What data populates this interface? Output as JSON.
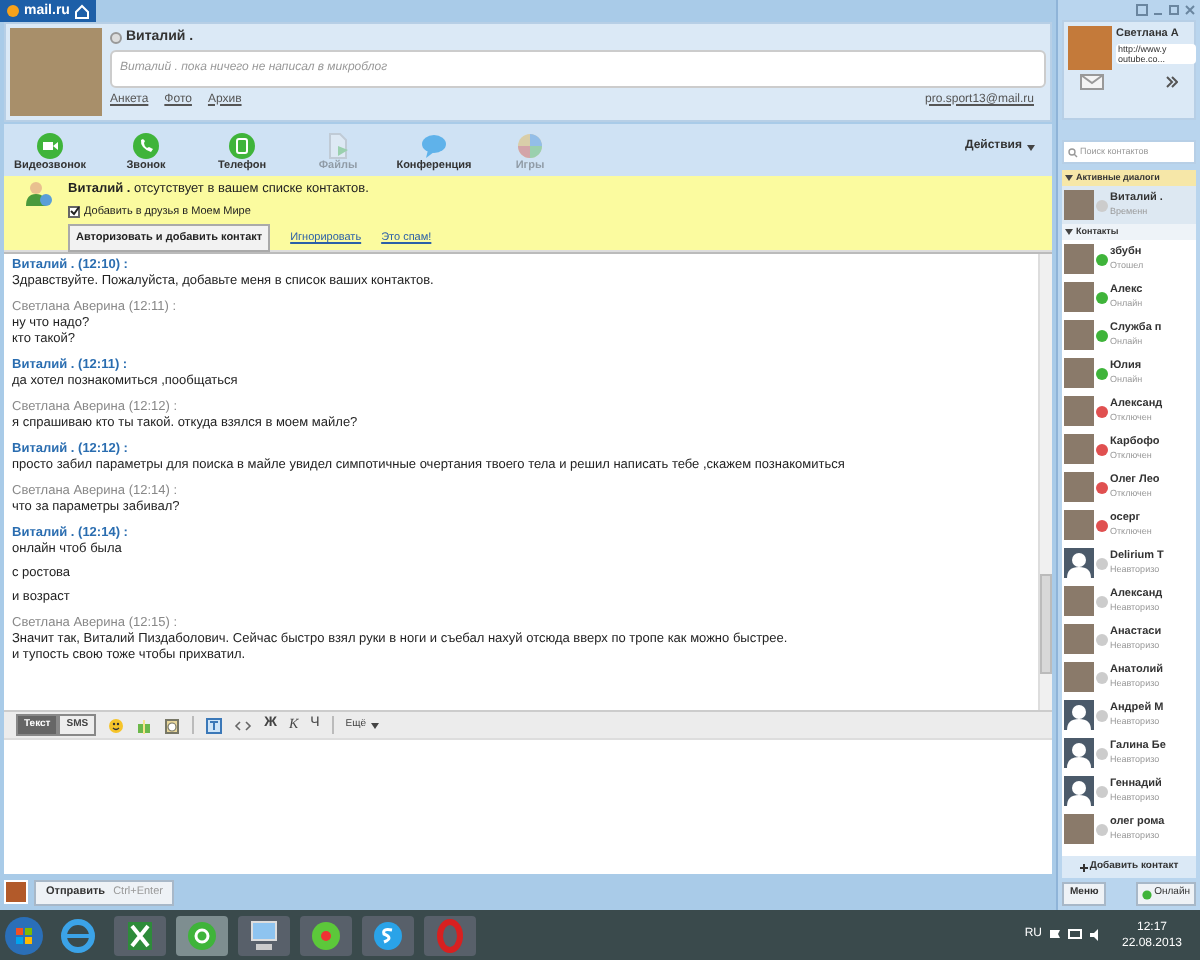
{
  "top_bar": {
    "logo": "mail.ru"
  },
  "profile": {
    "name": "Виталий .",
    "microblog_placeholder": "Виталий . пока ничего не написал в микроблог",
    "links": [
      "Анкета",
      "Фото",
      "Архив"
    ],
    "email": "pro.sport13@mail.ru"
  },
  "toolbar": {
    "items": [
      {
        "kind": "video",
        "label": "Видеозвонок",
        "disabled": false
      },
      {
        "kind": "call",
        "label": "Звонок",
        "disabled": false
      },
      {
        "kind": "phone",
        "label": "Телефон",
        "disabled": false
      },
      {
        "kind": "files",
        "label": "Файлы",
        "disabled": true
      },
      {
        "kind": "conference",
        "label": "Конференция",
        "disabled": false
      },
      {
        "kind": "games",
        "label": "Игры",
        "disabled": true
      }
    ],
    "actions": "Действия"
  },
  "notice": {
    "text": "**Виталий .** отсутствует в вашем списке контактов.",
    "checkbox": {
      "label": "Добавить в друзья в Моем Мире",
      "checked": true
    },
    "button": "Авторизовать и добавить контакт",
    "links": [
      "Игнорировать",
      "Это спам!"
    ]
  },
  "messages": [
    {
      "kind": "contact",
      "header": "Виталий . (12:10) :",
      "lines": [
        "Здравствуйте. Пожалуйста, добавьте меня в список ваших контактов."
      ]
    },
    {
      "kind": "me",
      "header": "Светлана Аверина (12:11) :",
      "lines": [
        "ну что надо?",
        "кто такой?"
      ]
    },
    {
      "kind": "contact",
      "header": "Виталий . (12:11) :",
      "lines": [
        "да хотел познакомиться ,пообщаться"
      ]
    },
    {
      "kind": "me",
      "header": "Светлана Аверина (12:12) :",
      "lines": [
        "я спрашиваю кто ты такой. откуда взялся в моем майле?"
      ]
    },
    {
      "kind": "contact",
      "header": "Виталий . (12:12) :",
      "lines": [
        "просто забил параметры для поиска в майле увидел симпотичные очертания твоего тела и решил написать тебе ,скажем познакомиться"
      ]
    },
    {
      "kind": "me",
      "header": "Светлана Аверина (12:14) :",
      "lines": [
        "что за параметры забивал?"
      ]
    },
    {
      "kind": "contact",
      "header": "Виталий . (12:14) :",
      "lines": [
        "онлайн чтоб была",
        "с ростова",
        "и возраст"
      ]
    },
    {
      "kind": "me",
      "header": "Светлана Аверина (12:15) :",
      "lines": [
        "Значит так, Виталий Пиздаболович. Сейчас быстро взял руки в ноги и съебал нахуй отсюда вверх по тропе как можно быстрее.",
        "и тупость свою тоже чтобы прихватил."
      ]
    }
  ],
  "format_bar": {
    "modes": [
      {
        "label": "Текст",
        "selected": true
      },
      {
        "label": "SMS",
        "selected": false
      }
    ],
    "bold": "Ж",
    "italic": "К",
    "underline": "Ч",
    "more": "Ещё"
  },
  "send": {
    "label": "Отправить",
    "shortcut": "Ctrl+Enter"
  },
  "sidebar": {
    "own": {
      "name": "Светлана А",
      "status": "http://www.y outube.co..."
    },
    "search_placeholder": "Поиск контактов",
    "active_header": "Активные диалоги",
    "active": [
      {
        "name": "Виталий .",
        "status": "Временн",
        "color": "#cccccc",
        "kind": "photo"
      }
    ],
    "contacts_header": "Контакты",
    "contacts": [
      {
        "name": "збубн",
        "status": "Отошел",
        "color": "#3fb43a",
        "kind": "photo"
      },
      {
        "name": "Алекс",
        "status": "Онлайн",
        "color": "#3fb43a",
        "kind": "photo"
      },
      {
        "name": "Служба п",
        "status": "Онлайн",
        "color": "#3fb43a",
        "kind": "photo"
      },
      {
        "name": "Юлия",
        "status": "Онлайн",
        "color": "#3fb43a",
        "kind": "photo"
      },
      {
        "name": "Александ",
        "status": "Отключен",
        "color": "#e05050",
        "kind": "photo"
      },
      {
        "name": "Карбофо",
        "status": "Отключен",
        "color": "#e05050",
        "kind": "photo"
      },
      {
        "name": "Олег Лео",
        "status": "Отключен",
        "color": "#e05050",
        "kind": "photo"
      },
      {
        "name": "осерг",
        "status": "Отключен",
        "color": "#e05050",
        "kind": "photo"
      },
      {
        "name": "Delirium T",
        "status": "Неавторизо",
        "color": "#cccccc",
        "kind": "silhouette"
      },
      {
        "name": "Александ",
        "status": "Неавторизо",
        "color": "#cccccc",
        "kind": "photo"
      },
      {
        "name": "Анастаси",
        "status": "Неавторизо",
        "color": "#cccccc",
        "kind": "photo"
      },
      {
        "name": "Анатолий",
        "status": "Неавторизо",
        "color": "#cccccc",
        "kind": "photo"
      },
      {
        "name": "Андрей М",
        "status": "Неавторизо",
        "color": "#cccccc",
        "kind": "silhouette"
      },
      {
        "name": "Галина Бе",
        "status": "Неавторизо",
        "color": "#cccccc",
        "kind": "silhouette"
      },
      {
        "name": "Геннадий",
        "status": "Неавторизо",
        "color": "#cccccc",
        "kind": "silhouette"
      },
      {
        "name": "олег рома",
        "status": "Неавторизо",
        "color": "#cccccc",
        "kind": "photo"
      }
    ],
    "add_contact": "Добавить контакт",
    "menu": "Меню",
    "presence_button": "Онлайн"
  },
  "taskbar": {
    "language": "RU",
    "time": "12:17",
    "date": "22.08.2013"
  }
}
